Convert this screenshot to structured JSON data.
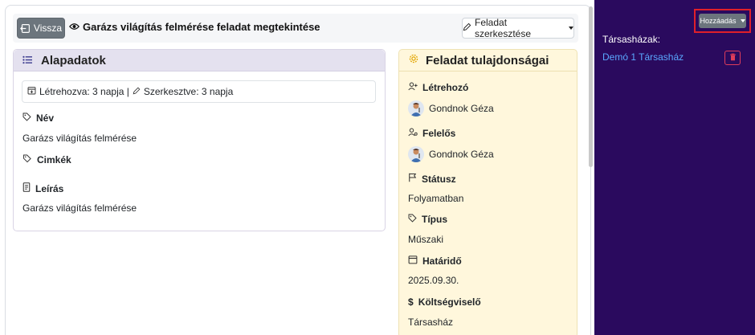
{
  "header": {
    "back_label": "Vissza",
    "title": "Garázs világítás felmérése feladat megtekintése",
    "edit_label": "Feladat szerkesztése"
  },
  "basics": {
    "title": "Alapadatok",
    "meta": "Létrehozva: 3 napja | ",
    "meta_edited": "Szerkesztve: 3 napja",
    "name_label": "Név",
    "name_value": "Garázs világítás felmérése",
    "tags_label": "Cimkék",
    "desc_label": "Leírás",
    "desc_value": "Garázs világítás felmérése"
  },
  "props": {
    "title": "Feladat tulajdonságai",
    "creator_label": "Létrehozó",
    "creator_value": "Gondnok Géza",
    "owner_label": "Felelős",
    "owner_value": "Gondnok Géza",
    "status_label": "Státusz",
    "status_value": "Folyamatban",
    "type_label": "Típus",
    "type_value": "Műszaki",
    "deadline_label": "Határidő",
    "deadline_value": "2025.09.30.",
    "cost_label": "Költségviselő",
    "cost_value": "Társasház"
  },
  "sidebar": {
    "add_label": "Hozzáadás",
    "title": "Társasházak:",
    "items": [
      {
        "label": "Demó 1 Társasház"
      }
    ]
  },
  "colors": {
    "sidebar_bg": "#2a0a5e",
    "props_bg": "#fff7dc",
    "basics_header_bg": "#e4e1ef",
    "highlight": "#e0202a",
    "link": "#5aa8ff"
  }
}
